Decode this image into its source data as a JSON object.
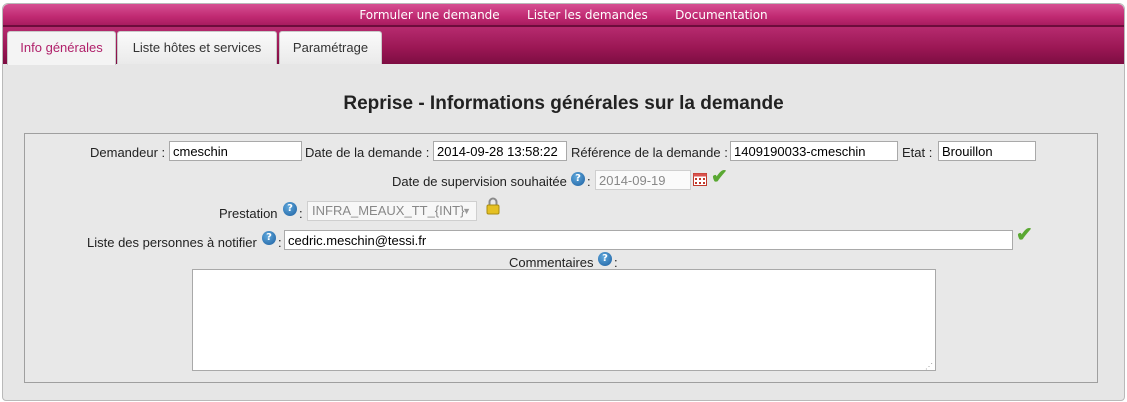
{
  "nav": {
    "items": [
      {
        "label": "Formuler une demande"
      },
      {
        "label": "Lister les demandes"
      },
      {
        "label": "Documentation"
      }
    ]
  },
  "tabs": [
    {
      "label": "Info générales",
      "active": true
    },
    {
      "label": "Liste hôtes et services",
      "active": false
    },
    {
      "label": "Paramétrage",
      "active": false
    }
  ],
  "page": {
    "title": "Reprise - Informations générales sur la demande"
  },
  "form": {
    "demandeur": {
      "label": "Demandeur :",
      "value": "cmeschin"
    },
    "date_demande": {
      "label": "Date de la demande :",
      "value": "2014-09-28 13:58:22"
    },
    "reference": {
      "label": "Référence de la demande :",
      "value": "1409190033-cmeschin"
    },
    "etat": {
      "label": "Etat :",
      "value": "Brouillon"
    },
    "date_supervision": {
      "label": "Date de supervision souhaitée",
      "suffix": ":",
      "value": "2014-09-19"
    },
    "prestation": {
      "label": "Prestation",
      "suffix": ":",
      "value": "INFRA_MEAUX_TT_{INT}"
    },
    "notifier": {
      "label": "Liste des personnes à notifier",
      "suffix": ":",
      "value": "cedric.meschin@tessi.fr"
    },
    "commentaires": {
      "label": "Commentaires",
      "suffix": ":",
      "value": ""
    }
  },
  "icons": {
    "help": "question-circle-icon",
    "calendar": "calendar-icon",
    "valid": "checkmark-icon",
    "lock": "padlock-icon"
  },
  "colors": {
    "accent": "#b0206a",
    "nav_bg": "#c02a72",
    "valid": "#5aa832"
  }
}
